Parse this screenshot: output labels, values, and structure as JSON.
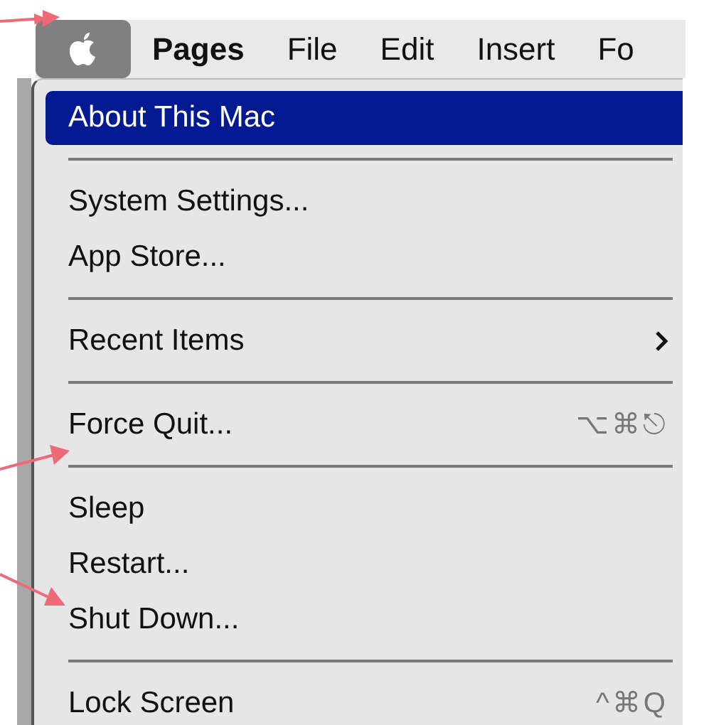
{
  "menu_bar": {
    "apple_button": {
      "selected": true
    },
    "items": [
      {
        "label": "Pages",
        "bold": true
      },
      {
        "label": "File",
        "bold": false
      },
      {
        "label": "Edit",
        "bold": false
      },
      {
        "label": "Insert",
        "bold": false
      },
      {
        "label": "Fo",
        "bold": false
      }
    ]
  },
  "menu": {
    "items": [
      {
        "kind": "item",
        "label": "About This Mac",
        "selected": true
      },
      {
        "kind": "separator"
      },
      {
        "kind": "item",
        "label": "System Settings...",
        "selected": false
      },
      {
        "kind": "item",
        "label": "App Store...",
        "selected": false
      },
      {
        "kind": "separator"
      },
      {
        "kind": "submenu",
        "label": "Recent Items",
        "selected": false
      },
      {
        "kind": "separator"
      },
      {
        "kind": "item",
        "label": "Force Quit...",
        "selected": false,
        "shortcut": "⌥⌘⎋"
      },
      {
        "kind": "separator"
      },
      {
        "kind": "item",
        "label": "Sleep",
        "selected": false
      },
      {
        "kind": "item",
        "label": "Restart...",
        "selected": false
      },
      {
        "kind": "item",
        "label": "Shut Down...",
        "selected": false
      },
      {
        "kind": "separator"
      },
      {
        "kind": "item",
        "label": "Lock Screen",
        "selected": false,
        "shortcut": "^⌘Q"
      }
    ]
  }
}
